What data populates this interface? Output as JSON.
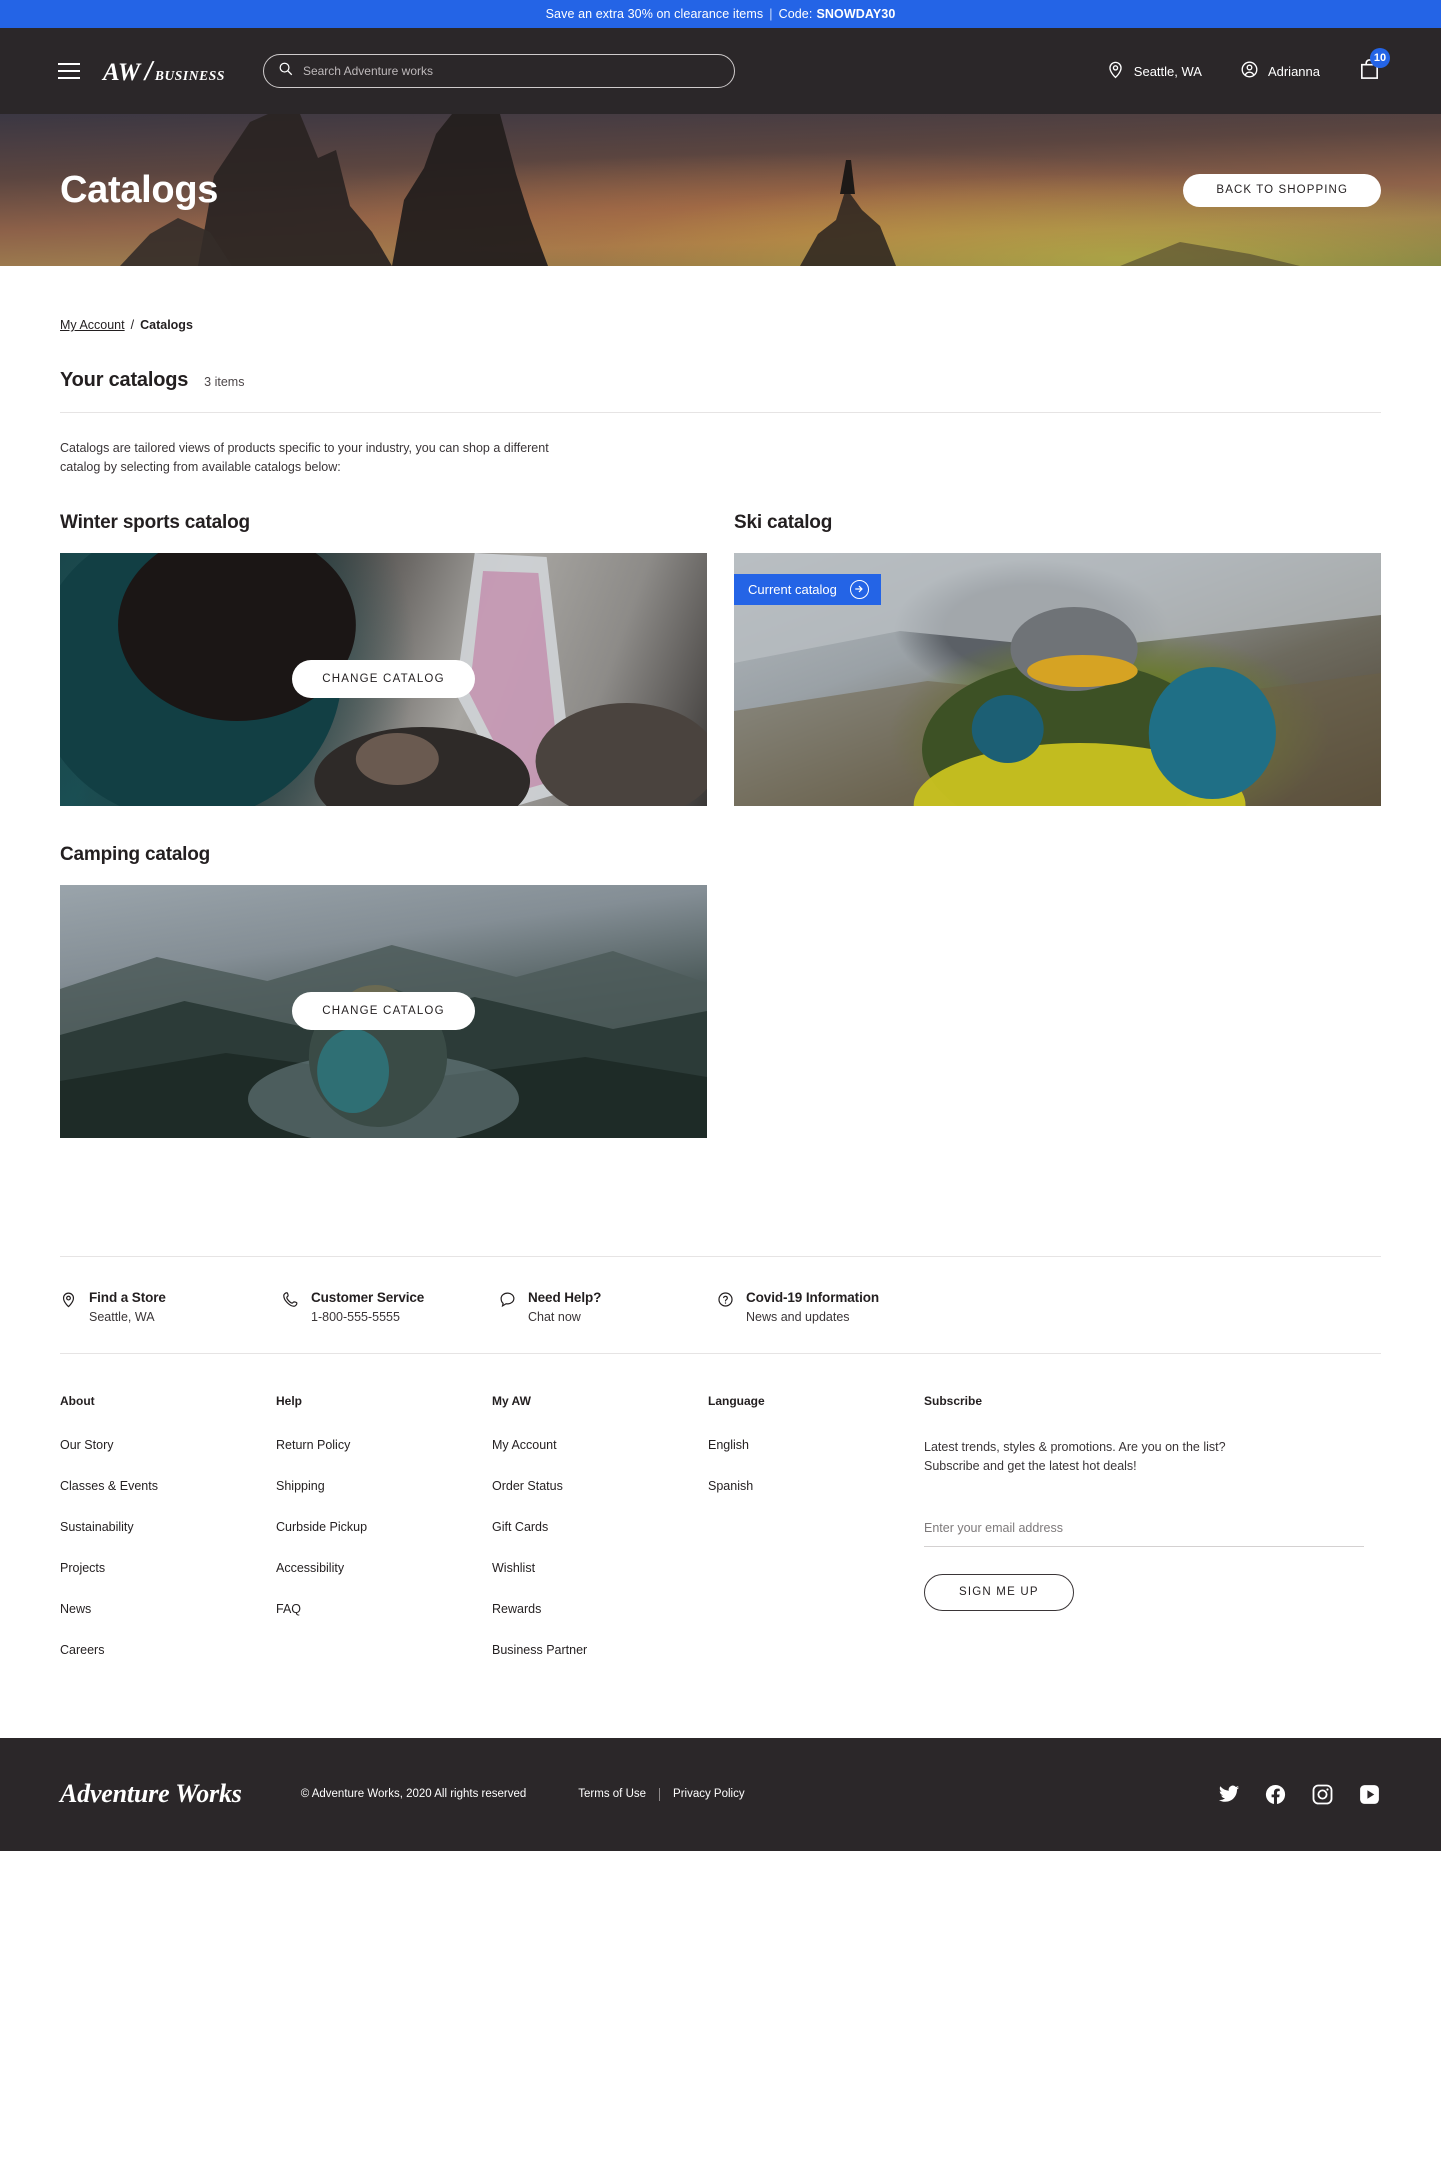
{
  "promo": {
    "message": "Save an extra 30% on clearance items",
    "separator": "|",
    "code_label": "Code:",
    "code": "SNOWDAY30"
  },
  "header": {
    "menu_icon": "hamburger-icon",
    "logo_main": "AW",
    "logo_slash": "/",
    "logo_sub": "BUSINESS",
    "search_placeholder": "Search Adventure works",
    "search_value": "",
    "location": "Seattle, WA",
    "account": "Adrianna",
    "cart_count": "10"
  },
  "hero": {
    "title": "Catalogs",
    "back_button": "BACK TO SHOPPING"
  },
  "breadcrumb": {
    "parent": "My Account",
    "divider": "/",
    "current": "Catalogs"
  },
  "section": {
    "title": "Your catalogs",
    "count": "3 items",
    "intro": "Catalogs are tailored views of products specific to your industry, you can shop a different catalog by selecting from available catalogs below:"
  },
  "catalogs": [
    {
      "title": "Winter sports catalog",
      "button": "CHANGE CATALOG",
      "is_current": false
    },
    {
      "title": "Ski catalog",
      "badge": "Current catalog",
      "is_current": true
    },
    {
      "title": "Camping catalog",
      "button": "CHANGE CATALOG",
      "is_current": false
    }
  ],
  "services": [
    {
      "icon": "location-pin-icon",
      "title": "Find a Store",
      "subtitle": "Seattle, WA"
    },
    {
      "icon": "phone-icon",
      "title": "Customer Service",
      "subtitle": "1-800-555-5555"
    },
    {
      "icon": "chat-bubble-icon",
      "title": "Need Help?",
      "subtitle": "Chat now"
    },
    {
      "icon": "question-circle-icon",
      "title": "Covid-19 Information",
      "subtitle": "News and updates"
    }
  ],
  "footer_columns": [
    {
      "heading": "About",
      "links": [
        "Our Story",
        "Classes & Events",
        "Sustainability",
        "Projects",
        "News",
        "Careers"
      ]
    },
    {
      "heading": "Help",
      "links": [
        "Return Policy",
        "Shipping",
        "Curbside Pickup",
        "Accessibility",
        "FAQ"
      ]
    },
    {
      "heading": "My AW",
      "links": [
        "My Account",
        "Order Status",
        "Gift Cards",
        "Wishlist",
        "Rewards",
        "Business Partner"
      ]
    },
    {
      "heading": "Language",
      "links": [
        "English",
        "Spanish"
      ]
    }
  ],
  "subscribe": {
    "heading": "Subscribe",
    "line1": "Latest trends, styles & promotions. Are you on the list?",
    "line2": "Subscribe and get the latest hot deals!",
    "email_placeholder": "Enter your email address",
    "email_value": "",
    "button": "SIGN ME UP"
  },
  "bottom": {
    "logo": "Adventure Works",
    "copyright": "© Adventure Works, 2020 All rights reserved",
    "terms": "Terms of Use",
    "privacy": "Privacy Policy",
    "socials": [
      "twitter-icon",
      "facebook-icon",
      "instagram-icon",
      "youtube-icon"
    ]
  },
  "colors": {
    "accent_blue": "#2464e6",
    "dark": "#2b2729",
    "white": "#ffffff"
  }
}
